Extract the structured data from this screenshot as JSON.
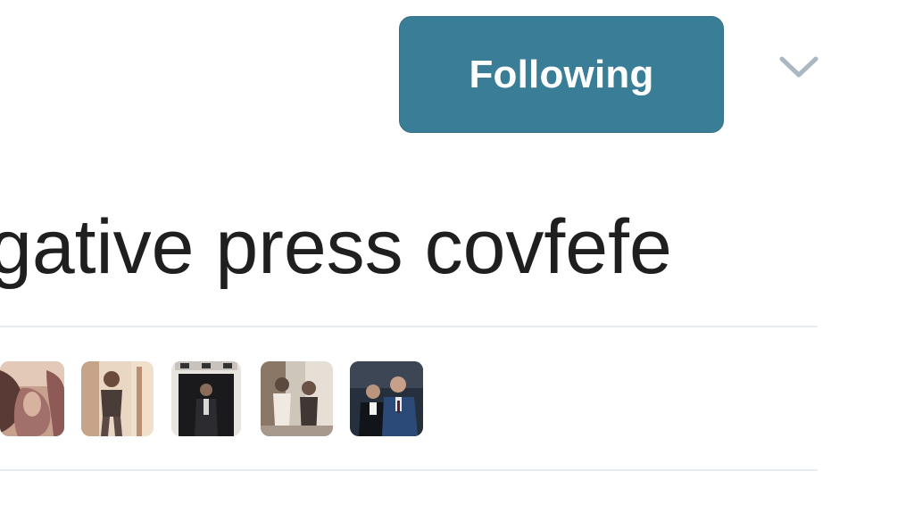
{
  "header": {
    "follow_button_label": "Following",
    "follow_button_color": "#3a7d96",
    "menu_icon": "chevron-down-icon"
  },
  "tweet": {
    "text": "gative press covfefe",
    "text_color": "#1f1f1f"
  },
  "liked_by": {
    "avatar_count_visible": 5
  }
}
